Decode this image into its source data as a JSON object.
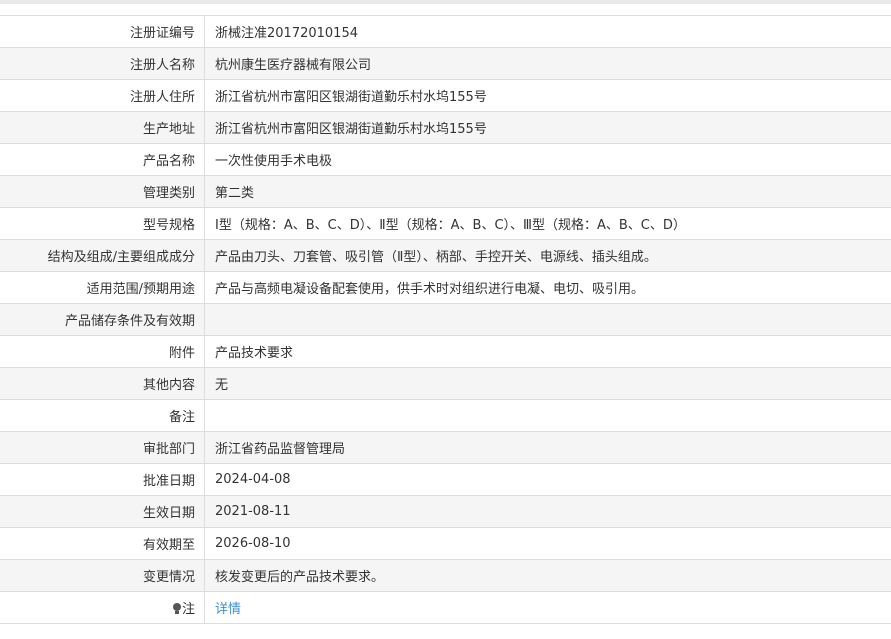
{
  "rows": [
    {
      "label": "注册证编号",
      "value": "浙械注准20172010154"
    },
    {
      "label": "注册人名称",
      "value": "杭州康生医疗器械有限公司"
    },
    {
      "label": "注册人住所",
      "value": "浙江省杭州市富阳区银湖街道勤乐村水坞155号"
    },
    {
      "label": "生产地址",
      "value": "浙江省杭州市富阳区银湖街道勤乐村水坞155号"
    },
    {
      "label": "产品名称",
      "value": "一次性使用手术电极"
    },
    {
      "label": "管理类别",
      "value": "第二类"
    },
    {
      "label": "型号规格",
      "value": "Ⅰ型（规格：A、B、C、D）、Ⅱ型（规格：A、B、C）、Ⅲ型（规格：A、B、C、D）"
    },
    {
      "label": "结构及组成/主要组成成分",
      "value": "产品由刀头、刀套管、吸引管（Ⅱ型）、柄部、手控开关、电源线、插头组成。"
    },
    {
      "label": "适用范围/预期用途",
      "value": "产品与高频电凝设备配套使用，供手术时对组织进行电凝、电切、吸引用。"
    },
    {
      "label": "产品储存条件及有效期",
      "value": ""
    },
    {
      "label": "附件",
      "value": "产品技术要求"
    },
    {
      "label": "其他内容",
      "value": "无"
    },
    {
      "label": "备注",
      "value": ""
    },
    {
      "label": "审批部门",
      "value": "浙江省药品监督管理局"
    },
    {
      "label": "批准日期",
      "value": "2024-04-08"
    },
    {
      "label": "生效日期",
      "value": "2021-08-11"
    },
    {
      "label": "有效期至",
      "value": "2026-08-10"
    },
    {
      "label": "变更情况",
      "value": "核发变更后的产品技术要求。"
    }
  ],
  "note_row": {
    "label": "注",
    "icon": "bulb-icon",
    "link_text": "详情",
    "link_color": "#3a8fd9"
  }
}
